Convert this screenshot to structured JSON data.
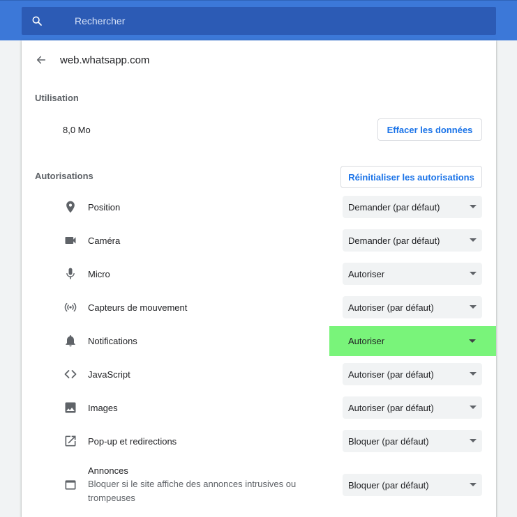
{
  "search": {
    "placeholder": "Rechercher",
    "icon": "search-icon"
  },
  "header": {
    "site": "web.whatsapp.com"
  },
  "usage": {
    "label": "Utilisation",
    "value": "8,0 Mo",
    "clear_button": "Effacer les données"
  },
  "permissions": {
    "label": "Autorisations",
    "reset_button": "Réinitialiser les autorisations",
    "items": [
      {
        "label": "Position",
        "value": "Demander (par défaut)",
        "icon": "location-icon"
      },
      {
        "label": "Caméra",
        "value": "Demander (par défaut)",
        "icon": "camera-icon"
      },
      {
        "label": "Micro",
        "value": "Autoriser",
        "icon": "microphone-icon"
      },
      {
        "label": "Capteurs de mouvement",
        "value": "Autoriser (par défaut)",
        "icon": "sensors-icon"
      },
      {
        "label": "Notifications",
        "value": "Autoriser",
        "icon": "bell-icon"
      },
      {
        "label": "JavaScript",
        "value": "Autoriser (par défaut)",
        "icon": "code-icon"
      },
      {
        "label": "Images",
        "value": "Autoriser (par défaut)",
        "icon": "image-icon"
      },
      {
        "label": "Pop-up et redirections",
        "value": "Bloquer (par défaut)",
        "icon": "open-in-new-icon"
      },
      {
        "label": "Annonces",
        "description": "Bloquer si le site affiche des annonces intrusives ou trompeuses",
        "value": "Bloquer (par défaut)",
        "icon": "ads-window-icon"
      }
    ]
  },
  "colors": {
    "topbar": "#3c78d8",
    "search_bg": "#2c5bb5",
    "accent": "#1a73e8",
    "highlight": "#79f47a"
  }
}
